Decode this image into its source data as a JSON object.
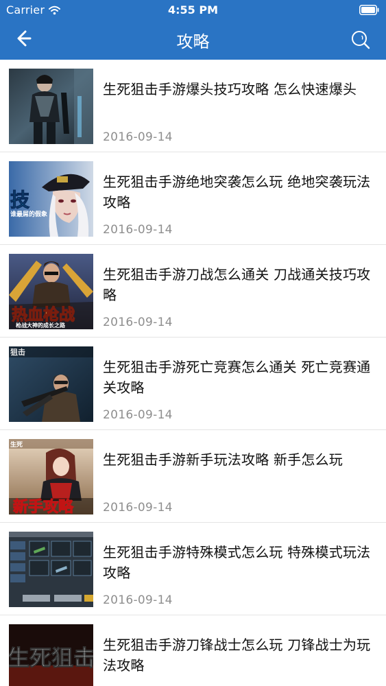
{
  "status_bar": {
    "carrier": "Carrier",
    "time": "4:55 PM",
    "wifi_icon": "wifi-icon",
    "battery_icon": "battery-icon"
  },
  "nav": {
    "title": "攻略",
    "back_icon": "arrow-left-icon",
    "search_icon": "search-icon",
    "background_color": "#2a74c4"
  },
  "articles": [
    {
      "title": "生死狙击手游爆头技巧攻略 怎么快速爆头",
      "date": "2016-09-14",
      "thumbnail": "armored-soldier-thumbnail"
    },
    {
      "title": "生死狙击手游绝地突袭怎么玩 绝地突袭玩法攻略",
      "date": "2016-09-14",
      "thumbnail": "officer-girl-thumbnail"
    },
    {
      "title": "生死狙击手游刀战怎么通关 刀战通关技巧攻略",
      "date": "2016-09-14",
      "thumbnail": "hot-blood-gunfight-thumbnail"
    },
    {
      "title": "生死狙击手游死亡竞赛怎么通关 死亡竞赛通关攻略",
      "date": "2016-09-14",
      "thumbnail": "gunner-character-thumbnail"
    },
    {
      "title": "生死狙击手游新手玩法攻略 新手怎么玩",
      "date": "2016-09-14",
      "thumbnail": "newbie-guide-thumbnail"
    },
    {
      "title": "生死狙击手游特殊模式怎么玩 特殊模式玩法攻略",
      "date": "2016-09-14",
      "thumbnail": "game-menu-screenshot-thumbnail"
    },
    {
      "title": "生死狙击手游刀锋战士怎么玩 刀锋战士为玩法攻略",
      "date": "",
      "thumbnail": "game-logo-thumbnail"
    }
  ],
  "thumbnail_text": {
    "t2_big": "技",
    "t2_small": "谁最屌的假象",
    "t3_big": "热血枪战",
    "t3_small": "枪战大神的成长之路",
    "t4_logo": "狙击",
    "t5_big": "新手攻略",
    "t5_logo": "生死",
    "t7_big": "生死狙击"
  }
}
